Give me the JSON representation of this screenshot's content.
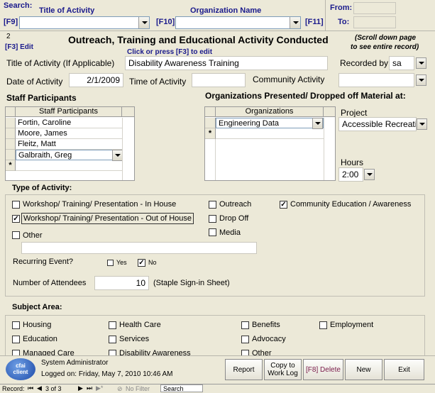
{
  "search": {
    "label": "Search:",
    "title_col": "Title of Activity",
    "org_col": "Organization Name",
    "f9": "[F9]",
    "f10": "[F10]",
    "f11": "[F11]",
    "from_label": "From:",
    "to_label": "To:"
  },
  "header": {
    "record_no": "2",
    "f3_edit": "[F3] Edit",
    "title": "Outreach, Training and Educational Activity Conducted",
    "hint": "Click or press [F3] to edit",
    "scroll_note_1": "(Scroll down page",
    "scroll_note_2": "to see entire record)"
  },
  "form": {
    "title_label": "Title of Activity (If Applicable)",
    "title_value": "Disability Awareness Training",
    "recorded_by_label": "Recorded by",
    "recorded_by_value": "sa",
    "date_label": "Date of Activity",
    "date_value": "2/1/2009",
    "time_label": "Time of Activity",
    "time_value": "",
    "community_label": "Community Activity",
    "community_value": ""
  },
  "staff": {
    "section_label": "Staff Participants",
    "column": "Staff Participants",
    "rows": [
      "Fortin, Caroline",
      "Moore, James",
      "Fleitz, Matt",
      "Galbraith, Greg"
    ],
    "new_row_marker": "*"
  },
  "orgs": {
    "section_label": "Organizations Presented/ Dropped off Material at:",
    "column": "Organizations",
    "rows": [
      "Engineering Data"
    ],
    "new_row_marker": "*"
  },
  "project": {
    "label": "Project",
    "value": "Accessible Recreation"
  },
  "hours": {
    "label": "Hours",
    "value": "2:00"
  },
  "type": {
    "label": "Type of Activity:",
    "workshop_in": "Workshop/ Training/ Presentation - In House",
    "workshop_out": "Workshop/ Training/ Presentation - Out of House",
    "other": "Other",
    "outreach": "Outreach",
    "dropoff": "Drop Off",
    "media": "Media",
    "community_ed": "Community Education / Awareness",
    "other_value": ""
  },
  "recurring": {
    "label": "Recurring Event?",
    "yes": "Yes",
    "no": "No"
  },
  "attendees": {
    "label": "Number of Attendees",
    "value": "10",
    "note": "(Staple Sign-in Sheet)"
  },
  "subject": {
    "label": "Subject Area:",
    "items": [
      "Housing",
      "Health Care",
      "Benefits",
      "Employment",
      "Education",
      "Services",
      "Advocacy",
      "Managed Care",
      "Disability Awareness",
      "Other"
    ]
  },
  "footer": {
    "logo_line1": "cfai",
    "logo_line2": "client",
    "user": "System Administrator",
    "logged_on": "Logged on: Friday, May 7, 2010 10:46 AM",
    "report": "Report",
    "copy_worklog": "Copy to Work Log",
    "delete": "[F8] Delete",
    "new": "New",
    "exit": "Exit"
  },
  "nav": {
    "record_label": "Record:",
    "current": "3 of 3",
    "filter": "No Filter",
    "search": "Search"
  },
  "colors": {
    "background": "#ece9d8",
    "navy": "#1a1a8c",
    "delete_text": "#7a1a4a"
  }
}
